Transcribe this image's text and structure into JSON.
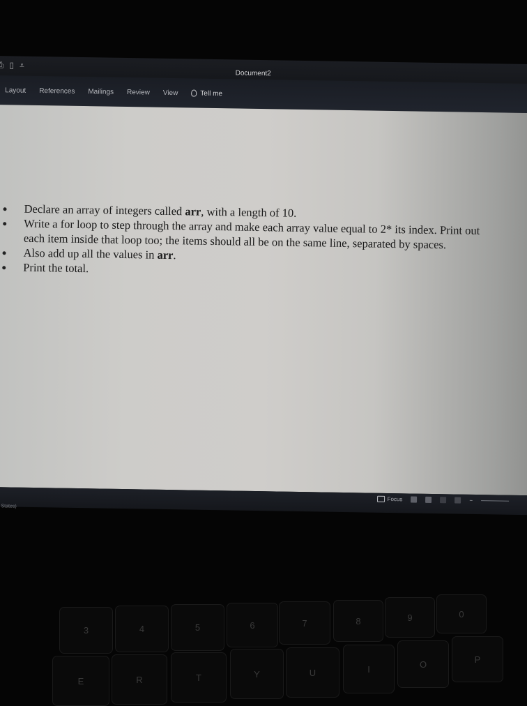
{
  "window": {
    "title": "Document2"
  },
  "ribbon": {
    "tabs": [
      {
        "label": "Layout"
      },
      {
        "label": "References"
      },
      {
        "label": "Mailings"
      },
      {
        "label": "Review"
      },
      {
        "label": "View"
      }
    ],
    "tell_me": "Tell me"
  },
  "document": {
    "items": [
      {
        "pre": "Declare an array of integers called ",
        "bold": "arr",
        "post": ", with a length of 10."
      },
      {
        "pre": "Write a for loop to step through the array and make each array value equal to 2* its index.  Print out each item inside that loop too; the items should all be on the same line, separated by spaces.",
        "bold": "",
        "post": ""
      },
      {
        "pre": "Also add up all the values in ",
        "bold": "arr",
        "post": "."
      },
      {
        "pre": "Print the total.",
        "bold": "",
        "post": ""
      }
    ]
  },
  "statusbar": {
    "language": "ted States)",
    "focus_label": "Focus"
  },
  "keyboard": {
    "number_keys": [
      "3",
      "4",
      "5",
      "6",
      "7",
      "8",
      "9",
      "0"
    ],
    "letter_keys": [
      "E",
      "R",
      "T",
      "Y",
      "U",
      "I",
      "O",
      "P"
    ]
  }
}
